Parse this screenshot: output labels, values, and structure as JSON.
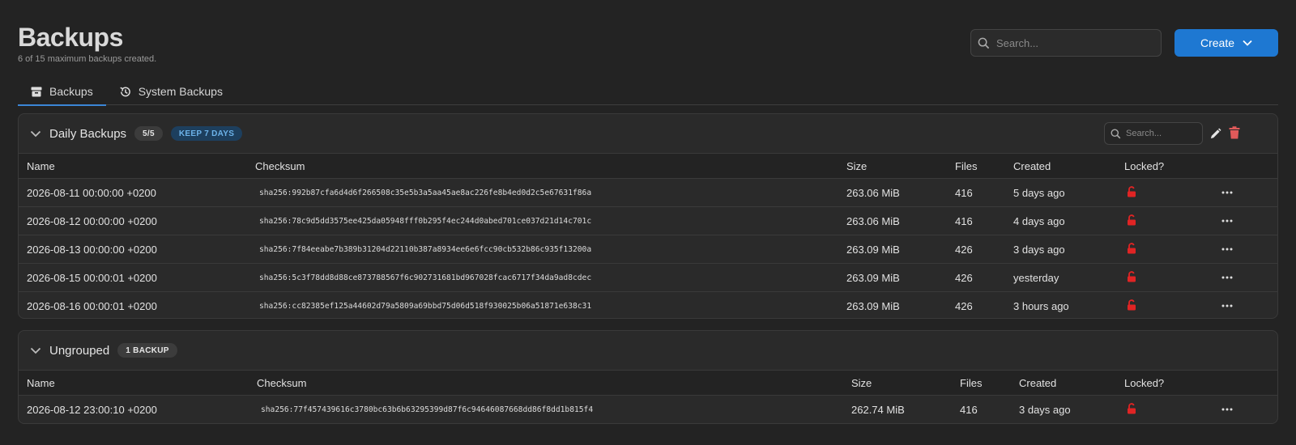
{
  "header": {
    "title": "Backups",
    "subtitle": "6 of 15 maximum backups created."
  },
  "search": {
    "placeholder": "Search..."
  },
  "create_button": {
    "label": "Create"
  },
  "tabs": [
    {
      "label": "Backups",
      "icon": "archive-icon",
      "active": true
    },
    {
      "label": "System Backups",
      "icon": "history-icon",
      "active": false
    }
  ],
  "columns": {
    "name": "Name",
    "checksum": "Checksum",
    "size": "Size",
    "files": "Files",
    "created": "Created",
    "locked": "Locked?"
  },
  "groups": [
    {
      "title": "Daily Backups",
      "count_badge": "5/5",
      "retention_badge": "KEEP 7 DAYS",
      "search_placeholder": "Search...",
      "rows": [
        {
          "name": "2026-08-11 00:00:00 +0200",
          "checksum": "sha256:992b87cfa6d4d6f266508c35e5b3a5aa45ae8ac226fe8b4ed0d2c5e67631f86a",
          "size": "263.06 MiB",
          "files": "416",
          "created": "5 days ago"
        },
        {
          "name": "2026-08-12 00:00:00 +0200",
          "checksum": "sha256:78c9d5dd3575ee425da05948fff0b295f4ec244d0abed701ce037d21d14c701c",
          "size": "263.06 MiB",
          "files": "416",
          "created": "4 days ago"
        },
        {
          "name": "2026-08-13 00:00:00 +0200",
          "checksum": "sha256:7f84eeabe7b389b31204d22110b387a8934ee6e6fcc90cb532b86c935f13200a",
          "size": "263.09 MiB",
          "files": "426",
          "created": "3 days ago"
        },
        {
          "name": "2026-08-15 00:00:01 +0200",
          "checksum": "sha256:5c3f78dd8d88ce873788567f6c902731681bd967028fcac6717f34da9ad8cdec",
          "size": "263.09 MiB",
          "files": "426",
          "created": "yesterday"
        },
        {
          "name": "2026-08-16 00:00:01 +0200",
          "checksum": "sha256:cc82385ef125a44602d79a5809a69bbd75d06d518f930025b06a51871e638c31",
          "size": "263.09 MiB",
          "files": "426",
          "created": "3 hours ago"
        }
      ]
    },
    {
      "title": "Ungrouped",
      "count_badge": "1 BACKUP",
      "rows": [
        {
          "name": "2026-08-12 23:00:10 +0200",
          "checksum": "sha256:77f457439616c3780bc63b6b63295399d87f6c94646087668dd86f8dd1b815f4",
          "size": "262.74 MiB",
          "files": "416",
          "created": "3 days ago"
        }
      ]
    }
  ],
  "colors": {
    "accent": "#1e78d2",
    "lock": "#e02424",
    "delete": "#e05a5a",
    "background": "#232323"
  }
}
